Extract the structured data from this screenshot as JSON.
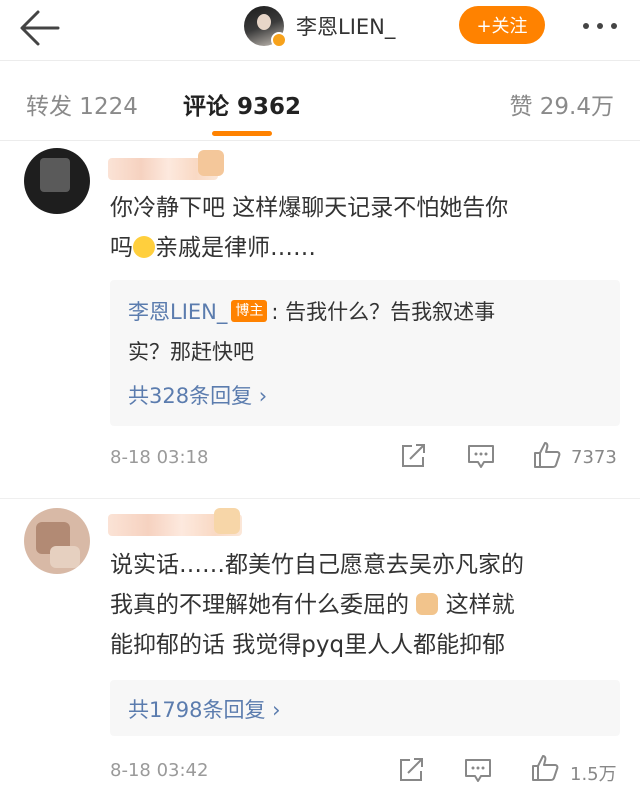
{
  "header": {
    "back_icon": "back-arrow-icon",
    "profile_name": "李恩LIEN_",
    "follow_label": "+关注",
    "more_icon": "more-dots-icon"
  },
  "tabs": {
    "repost": "转发 1224",
    "comment": "评论 9362",
    "like": "赞 29.4万"
  },
  "comments": [
    {
      "text_line1": "你冷静下吧 这样爆聊天记录不怕她告你",
      "text_line2_pre": "吗",
      "emoji": "laughing-crying-emoji",
      "text_line2_post": "亲戚是律师……",
      "reply": {
        "user": "李恩LIEN_",
        "badge": "博主",
        "text_line1": ": 告我什么？告我叙述事",
        "text_line2": "实？那赶快吧",
        "count": "共328条回复 ›"
      },
      "time": "8-18 03:18",
      "likes": "7373"
    },
    {
      "text_line1": "说实话……都美竹自己愿意去吴亦凡家的",
      "text_line2_pre": "我真的不理解她有什么委屈的",
      "emoji": "folded-hands-emoji",
      "text_line2_post": "这样就",
      "text_line3": "能抑郁的话 我觉得pyq里人人都能抑郁",
      "reply": {
        "count": "共1798条回复 ›"
      },
      "time": "8-18 03:42",
      "likes": "1.5万"
    }
  ],
  "colors": {
    "accent": "#ff8200",
    "link": "#5b7cae",
    "muted": "#9a9a9a"
  }
}
